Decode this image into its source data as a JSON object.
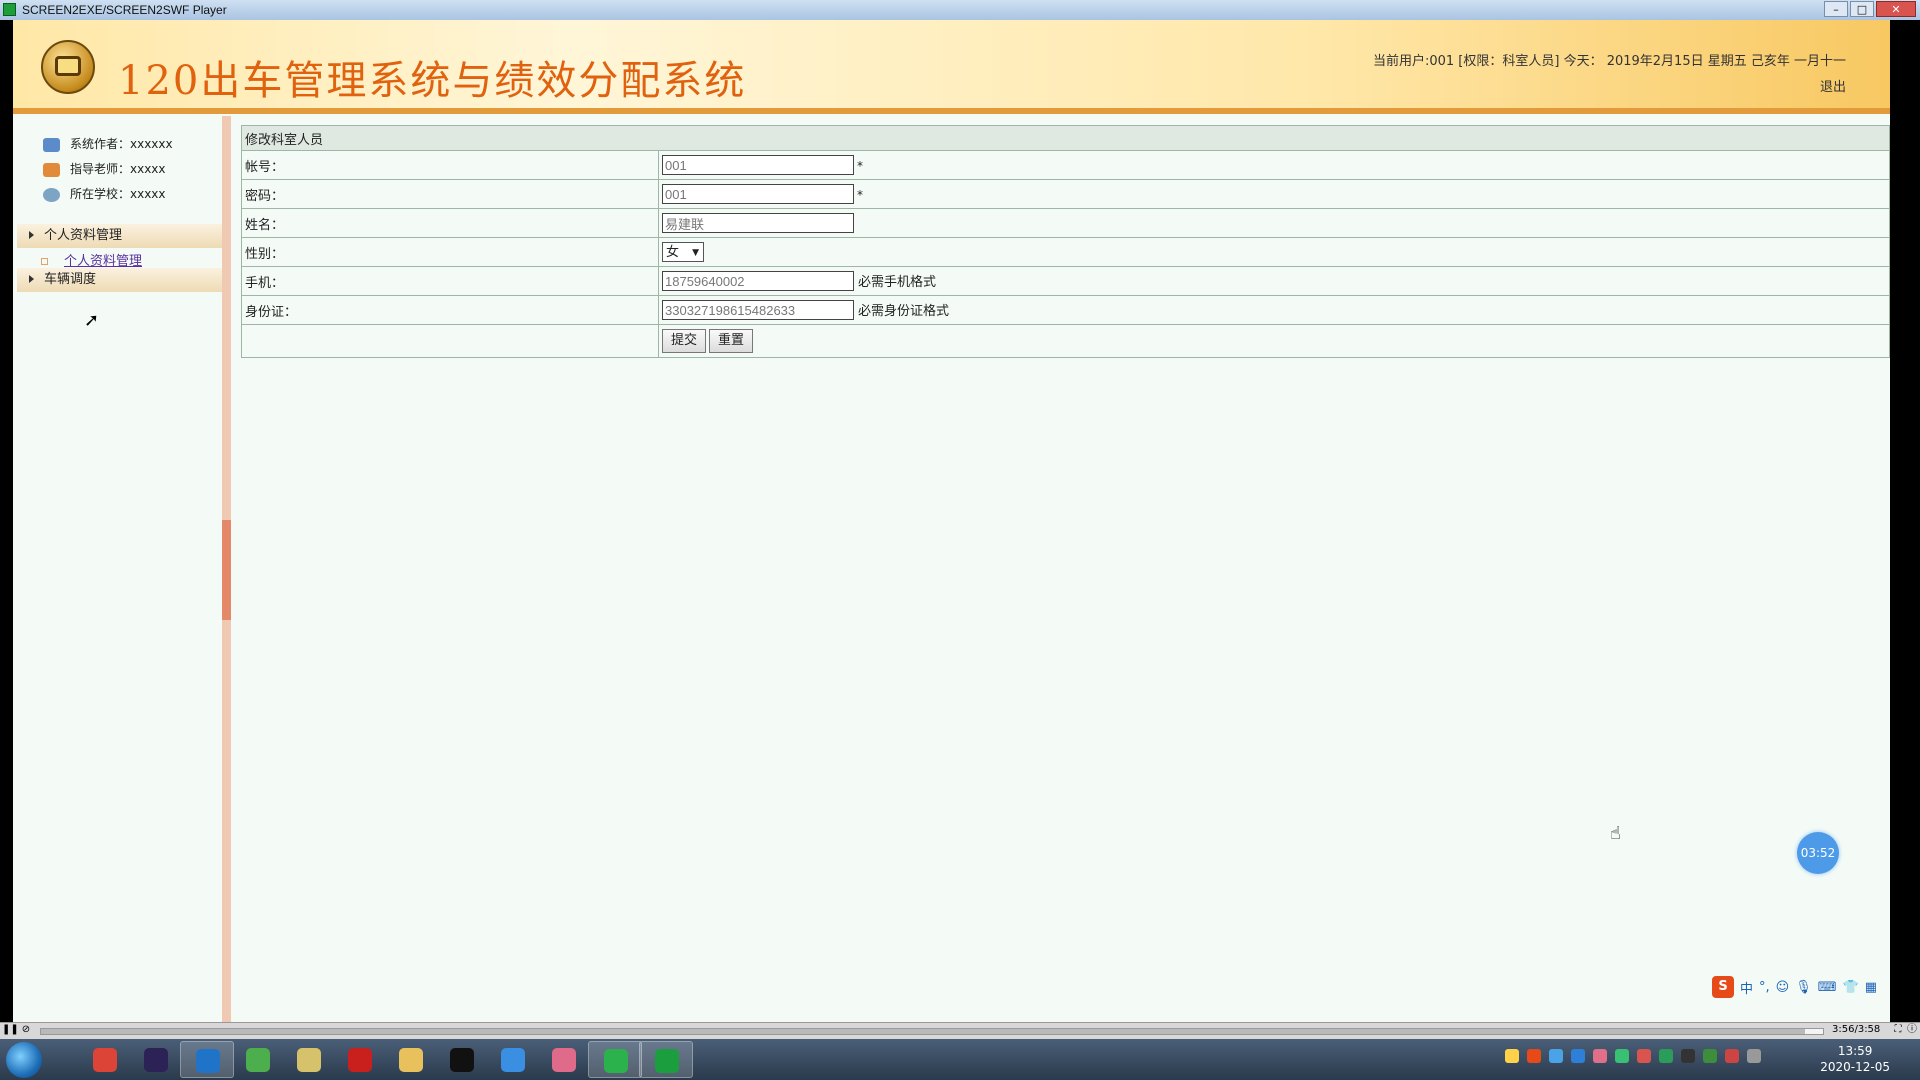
{
  "window": {
    "title": "SCREEN2EXE/SCREEN2SWF Player"
  },
  "header": {
    "system_title": "120出车管理系统与绩效分配系统",
    "user_info": "当前用户:001 [权限：科室人员] 今天： 2019年2月15日 星期五 己亥年 一月十一",
    "logout_label": "退出"
  },
  "sidebar": {
    "info": [
      {
        "label": "系统作者：xxxxxx",
        "icon": "person-icon"
      },
      {
        "label": "指导老师：xxxxx",
        "icon": "teacher-icon"
      },
      {
        "label": "所在学校：xxxxx",
        "icon": "school-icon"
      }
    ],
    "menus": [
      {
        "label": "个人资料管理",
        "items": [
          {
            "label": "个人资料管理"
          }
        ]
      },
      {
        "label": "车辆调度",
        "items": []
      }
    ]
  },
  "form": {
    "title": "修改科室人员",
    "fields": {
      "account": {
        "label": "帐号：",
        "value": "001",
        "required": "*"
      },
      "password": {
        "label": "密码：",
        "value": "001",
        "required": "*"
      },
      "name": {
        "label": "姓名：",
        "value": "易建联"
      },
      "gender": {
        "label": "性别：",
        "value": "女"
      },
      "phone": {
        "label": "手机：",
        "value": "18759640002",
        "hint": "必需手机格式"
      },
      "idcard": {
        "label": "身份证：",
        "value": "330327198615482633",
        "hint": "必需身份证格式"
      }
    },
    "submit_label": "提交",
    "reset_label": "重置"
  },
  "overlay": {
    "timer": "03:52",
    "ime_label": "中"
  },
  "player": {
    "time": "3:56/3:58",
    "progress": 0.99
  },
  "taskbar": {
    "time": "13:59",
    "date": "2020-12-05",
    "apps": [
      "chrome-icon",
      "eclipse-icon",
      "browser-icon",
      "360-icon",
      "notepad-icon",
      "flash-icon",
      "explorer-icon",
      "qq-icon",
      "baidu-netdisk-icon",
      "avatar-icon",
      "wechat-icon",
      "screen2exe-icon"
    ]
  },
  "colors": {
    "title_orange": "#e0620e",
    "header_border": "#e39a3b",
    "content_bg": "#f4fbf6"
  }
}
